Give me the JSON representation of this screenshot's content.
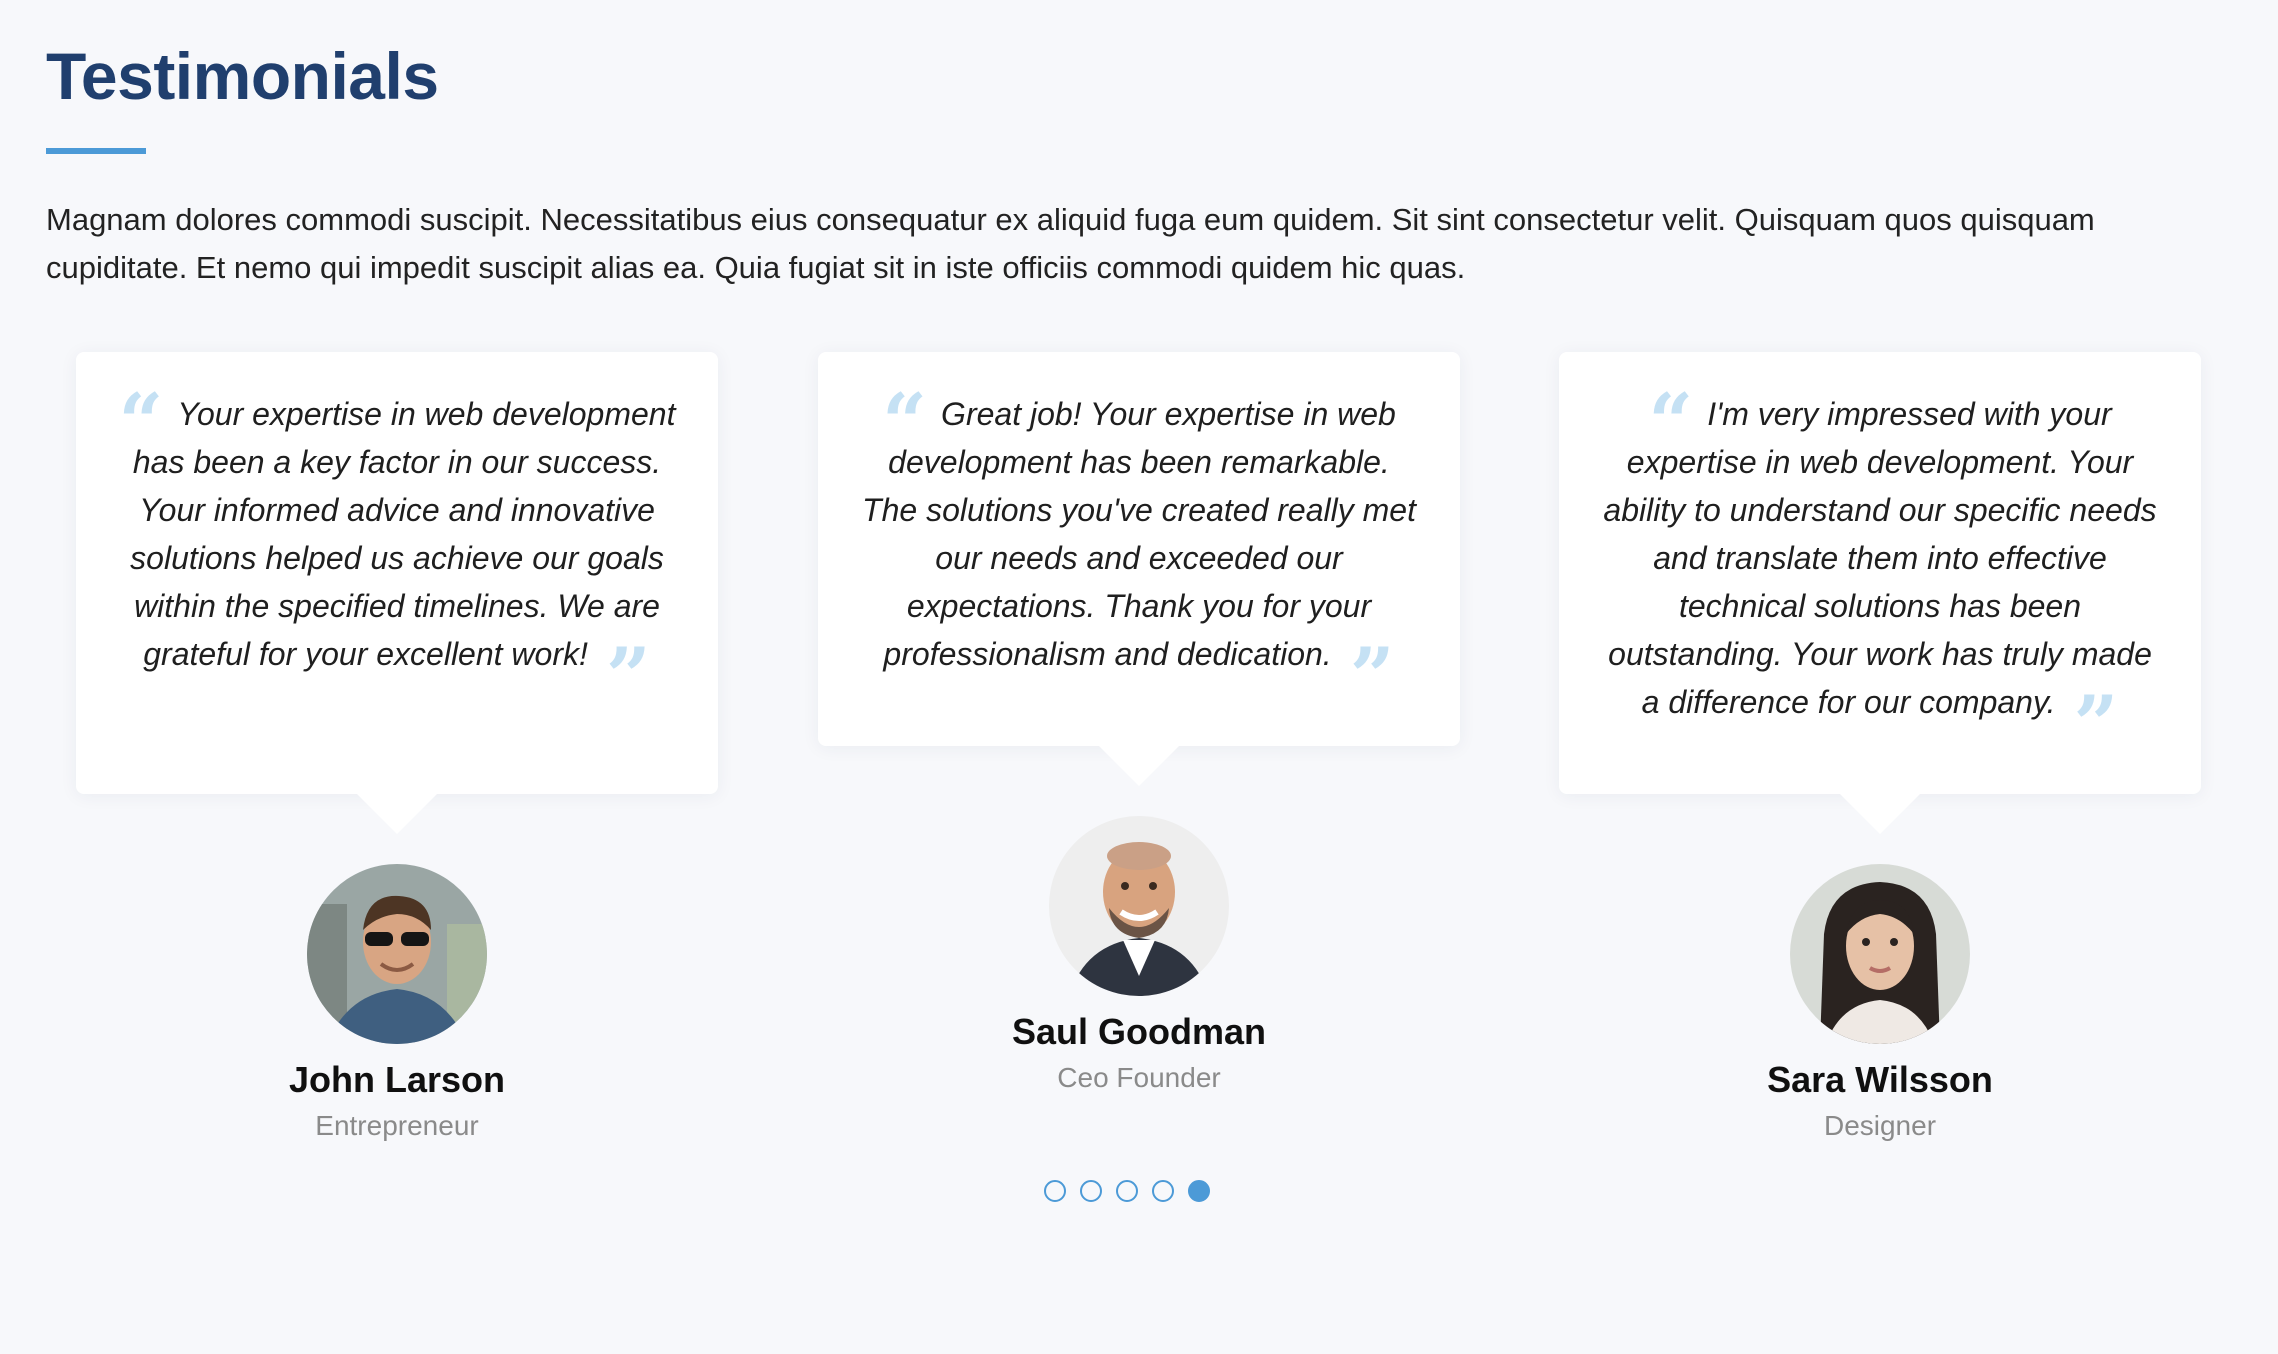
{
  "section": {
    "title": "Testimonials",
    "intro": "Magnam dolores commodi suscipit. Necessitatibus eius consequatur ex aliquid fuga eum quidem. Sit sint consectetur velit. Quisquam quos quisquam cupiditate. Et nemo qui impedit suscipit alias ea. Quia fugiat sit in iste officiis commodi quidem hic quas.",
    "accent_color": "#4c9ad7",
    "title_color": "#203f6e",
    "quote_color": "#c5e1f4"
  },
  "testimonials": [
    {
      "quote": "Your expertise in web development has been a key factor in our success. Your informed advice and innovative solutions helped us achieve our goals within the specified timelines. We are grateful for your excellent work!",
      "name": "John Larson",
      "role": "Entrepreneur",
      "open_quote": "“",
      "close_quote": "”"
    },
    {
      "quote": "Great job! Your expertise in web development has been remarkable. The solutions you've created really met our needs and exceeded our expectations. Thank you for your professionalism and dedication.",
      "name": "Saul Goodman",
      "role": "Ceo Founder",
      "open_quote": "“",
      "close_quote": "”"
    },
    {
      "quote": "I'm very impressed with your expertise in web development. Your ability to understand our specific needs and translate them into effective technical solutions has been outstanding. Your work has truly made a difference for our company.",
      "name": "Sara Wilsson",
      "role": "Designer",
      "open_quote": "“",
      "close_quote": "”"
    }
  ],
  "pagination": {
    "total": 5,
    "active_index": 4
  }
}
